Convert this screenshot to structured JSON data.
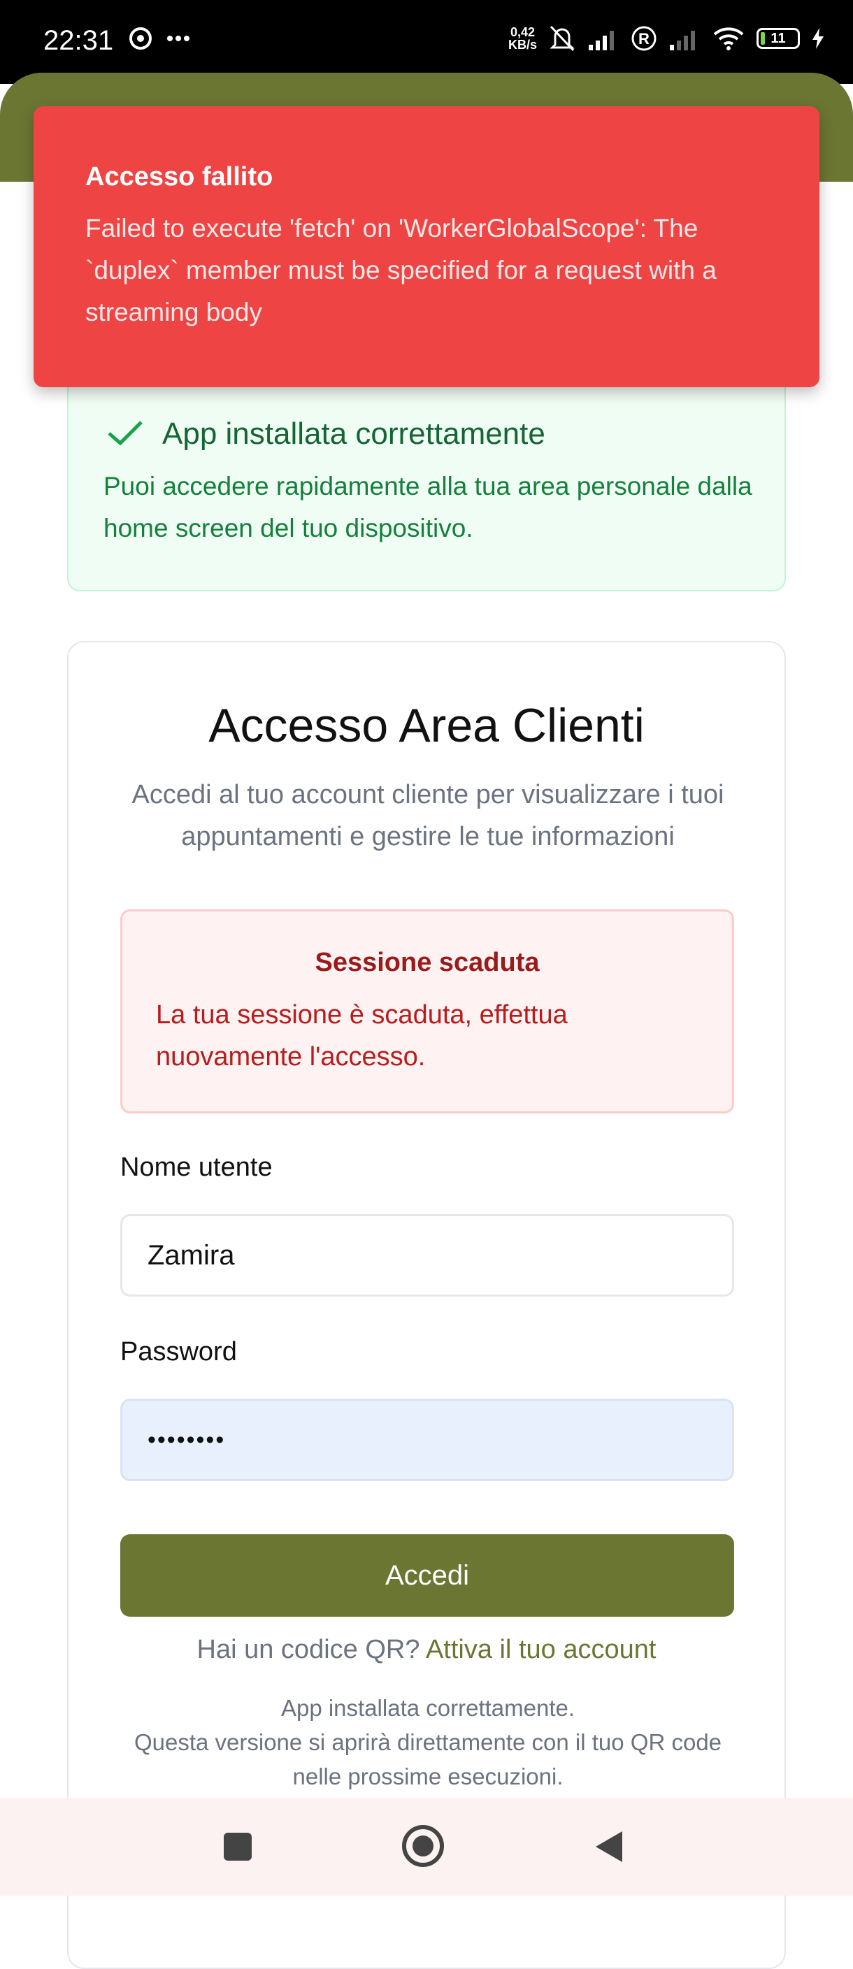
{
  "status_bar": {
    "time": "22:31",
    "speed_value": "0,42",
    "speed_unit": "KB/s",
    "battery": "11",
    "battery_fraction": 0.11,
    "icons": [
      "chrome-icon",
      "more-icon",
      "mute-bell-icon",
      "signal-icon",
      "roaming-icon",
      "signal-weak-icon",
      "wifi-icon",
      "battery-icon",
      "charging-icon"
    ]
  },
  "toast": {
    "title": "Accesso fallito",
    "message": "Failed to execute 'fetch' on 'WorkerGlobalScope': The `duplex` member must be specified for a request with a streaming body",
    "color": "#ef4444"
  },
  "install_notice": {
    "title": "App installata correttamente",
    "message": "Puoi accedere rapidamente alla tua area personale dalla home screen del tuo dispositivo.",
    "icon": "check-icon"
  },
  "login": {
    "title": "Accesso Area Clienti",
    "subtitle": "Accedi al tuo account cliente per visualizzare i tuoi appuntamenti e gestire le tue informazioni",
    "error": {
      "title": "Sessione scaduta",
      "message": "La tua sessione è scaduta, effettua nuovamente l'accesso."
    },
    "username_label": "Nome utente",
    "username_value": "Zamira",
    "password_label": "Password",
    "password_value": "••••••••",
    "submit_label": "Accedi",
    "qr_prompt": "Hai un codice QR?",
    "qr_link": "Attiva il tuo account",
    "note_line1": "App installata correttamente.",
    "note_line2": "Questa versione si aprirà direttamente con il tuo QR code nelle prossime esecuzioni."
  },
  "colors": {
    "brand": "#6b7633",
    "error": "#ef4444",
    "success_text": "#166534"
  },
  "nav_bar": {
    "buttons": [
      "recents-icon",
      "home-icon",
      "back-icon"
    ]
  }
}
